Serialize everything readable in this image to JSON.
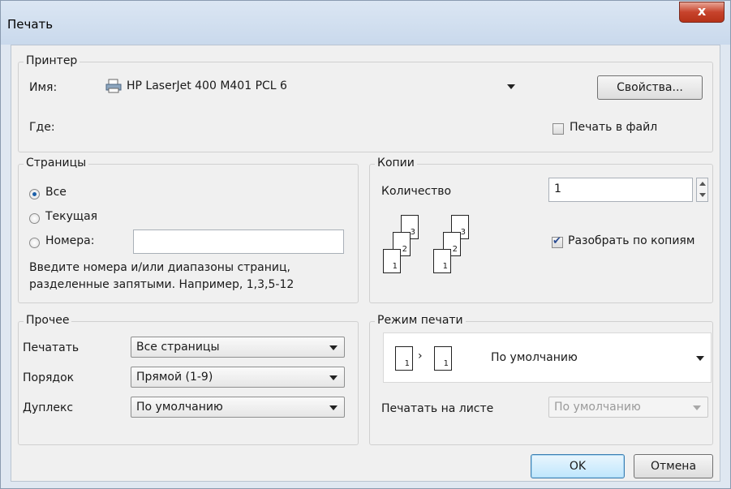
{
  "window": {
    "title": "Печать",
    "close_label": "x"
  },
  "printer": {
    "group_title": "Принтер",
    "name_label": "Имя:",
    "name_value": "HP LaserJet 400 M401 PCL 6",
    "where_label": "Где:",
    "properties_button": "Свойства...",
    "print_to_file_label": "Печать в файл",
    "print_to_file_checked": false
  },
  "pages": {
    "group_title": "Страницы",
    "all_label": "Все",
    "current_label": "Текущая",
    "numbers_label": "Номера:",
    "numbers_value": "",
    "selected": "all",
    "hint_line1": "Введите номера и/или диапазоны страниц,",
    "hint_line2": "разделенные запятыми. Например, 1,3,5-12"
  },
  "copies": {
    "group_title": "Копии",
    "count_label": "Количество",
    "count_value": "1",
    "collate_label": "Разобрать по копиям",
    "collate_checked": true,
    "page_numbers": [
      "3",
      "2",
      "1"
    ]
  },
  "other": {
    "group_title": "Прочее",
    "print_label": "Печатать",
    "print_value": "Все страницы",
    "order_label": "Порядок",
    "order_value": "Прямой (1-9)",
    "duplex_label": "Дуплекс",
    "duplex_value": "По умолчанию"
  },
  "print_mode": {
    "group_title": "Режим печати",
    "mode_value": "По умолчанию",
    "mode_page": "1",
    "per_sheet_label": "Печатать на листе",
    "per_sheet_value": "По умолчанию"
  },
  "buttons": {
    "ok": "OK",
    "cancel": "Отмена"
  }
}
